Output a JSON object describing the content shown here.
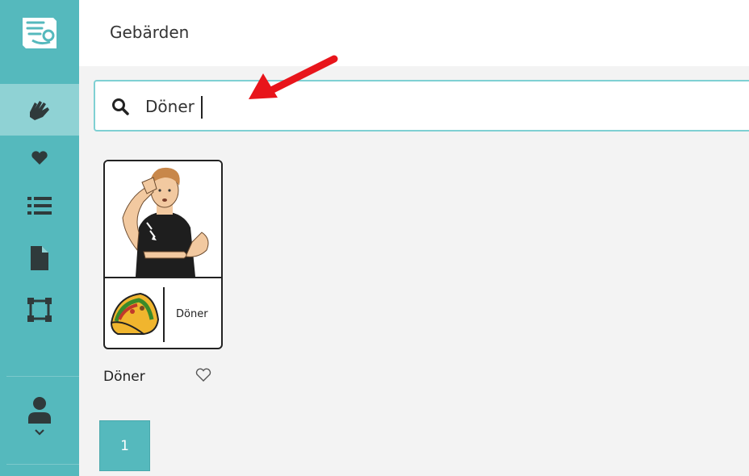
{
  "header": {
    "title": "Gebärden"
  },
  "search": {
    "value": "Döner",
    "placeholder": ""
  },
  "sidebar": {
    "items": [
      {
        "icon": "signing-hands-icon",
        "active": true
      },
      {
        "icon": "heart-icon"
      },
      {
        "icon": "list-icon"
      },
      {
        "icon": "document-icon"
      },
      {
        "icon": "frame-icon"
      }
    ],
    "user_icon": "user-icon",
    "user_menu_icon": "chevron-down-icon"
  },
  "results": [
    {
      "name": "Döner",
      "card_word": "Döner",
      "favorite": false
    }
  ],
  "pagination": {
    "current": "1"
  },
  "colors": {
    "accent": "#55b9bd",
    "accent_light": "#8fd2d4",
    "arrow": "#e8151b"
  }
}
